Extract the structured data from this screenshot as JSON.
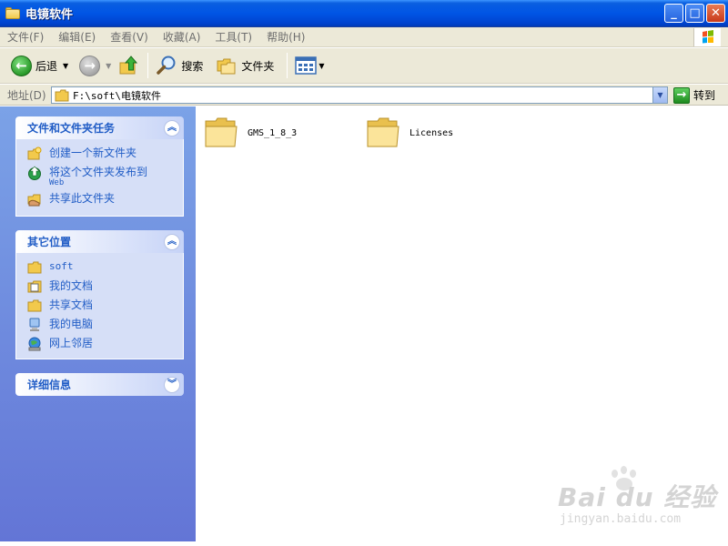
{
  "window": {
    "title": "电镜软件"
  },
  "menu": {
    "items": [
      "文件(F)",
      "编辑(E)",
      "查看(V)",
      "收藏(A)",
      "工具(T)",
      "帮助(H)"
    ]
  },
  "toolbar": {
    "back_label": "后退",
    "search_label": "搜索",
    "folders_label": "文件夹"
  },
  "address": {
    "label": "地址(D)",
    "path": "F:\\soft\\电镜软件",
    "go_label": "转到"
  },
  "taskpane": {
    "file_tasks": {
      "title": "文件和文件夹任务",
      "items": [
        {
          "label": "创建一个新文件夹",
          "icon": "new-folder-icon"
        },
        {
          "label": "将这个文件夹发布到",
          "sublabel": "Web",
          "icon": "publish-web-icon"
        },
        {
          "label": "共享此文件夹",
          "icon": "share-folder-icon"
        }
      ]
    },
    "other_places": {
      "title": "其它位置",
      "items": [
        {
          "label": "soft",
          "icon": "folder-icon"
        },
        {
          "label": "我的文档",
          "icon": "my-documents-icon"
        },
        {
          "label": "共享文档",
          "icon": "shared-documents-icon"
        },
        {
          "label": "我的电脑",
          "icon": "my-computer-icon"
        },
        {
          "label": "网上邻居",
          "icon": "network-places-icon"
        }
      ]
    },
    "details": {
      "title": "详细信息"
    }
  },
  "content": {
    "items": [
      {
        "name": "GMS_1_8_3",
        "type": "folder"
      },
      {
        "name": "Licenses",
        "type": "folder"
      }
    ]
  },
  "watermark": {
    "main": "Bai du 经验",
    "sub": "jingyan.baidu.com"
  }
}
